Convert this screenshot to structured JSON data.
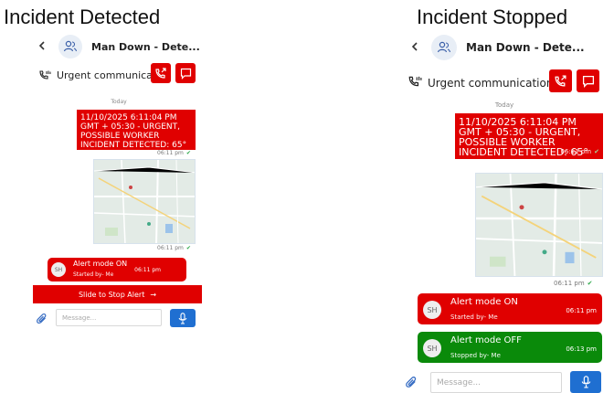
{
  "left": {
    "heading": "Incident Detected",
    "header_title": "Man Down - Dete...",
    "urgent_label": "Urgent communication",
    "today": "Today",
    "incident_text": "11/10/2025 6:11:04 PM GMT + 05:30 - URGENT, POSSIBLE WORKER INCIDENT DETECTED: 65°",
    "incident_time": "06:11 pm",
    "map_time": "06:11 pm",
    "alert_on": {
      "avatar": "SH",
      "label": "Alert mode ON",
      "sub": "Started by- Me",
      "time": "06:11 pm",
      "color": "#e00000"
    },
    "slide_label": "Slide to Stop Alert",
    "slide_arrow": "→",
    "message_placeholder": "Message..."
  },
  "right": {
    "heading": "Incident Stopped",
    "header_title": "Man Down - Dete...",
    "urgent_label": "Urgent communication",
    "today": "Today",
    "incident_text": "11/10/2025 6:11:04 PM GMT + 05:30 - URGENT, POSSIBLE WORKER INCIDENT DETECTED: 65°",
    "incident_time": "06:11 pm",
    "map_time": "06:11 pm",
    "alert_on": {
      "avatar": "SH",
      "label": "Alert mode ON",
      "sub": "Started by- Me",
      "time": "06:11 pm",
      "color": "#e00000"
    },
    "alert_off": {
      "avatar": "SH",
      "label": "Alert mode OFF",
      "sub": "Stopped by- Me",
      "time": "06:13 pm",
      "color": "#0a8a0a"
    },
    "message_placeholder": "Message..."
  },
  "icons": {
    "back": "chevron-left-icon",
    "group": "users-icon",
    "urgent": "phone-alert-icon",
    "call": "phone-outgoing-icon",
    "chat": "chat-icon",
    "attach": "paperclip-icon",
    "mic": "microphone-icon"
  },
  "colors": {
    "red": "#e00000",
    "green": "#0a8a0a",
    "blue": "#1f6fd1",
    "check": "#2da84a"
  }
}
